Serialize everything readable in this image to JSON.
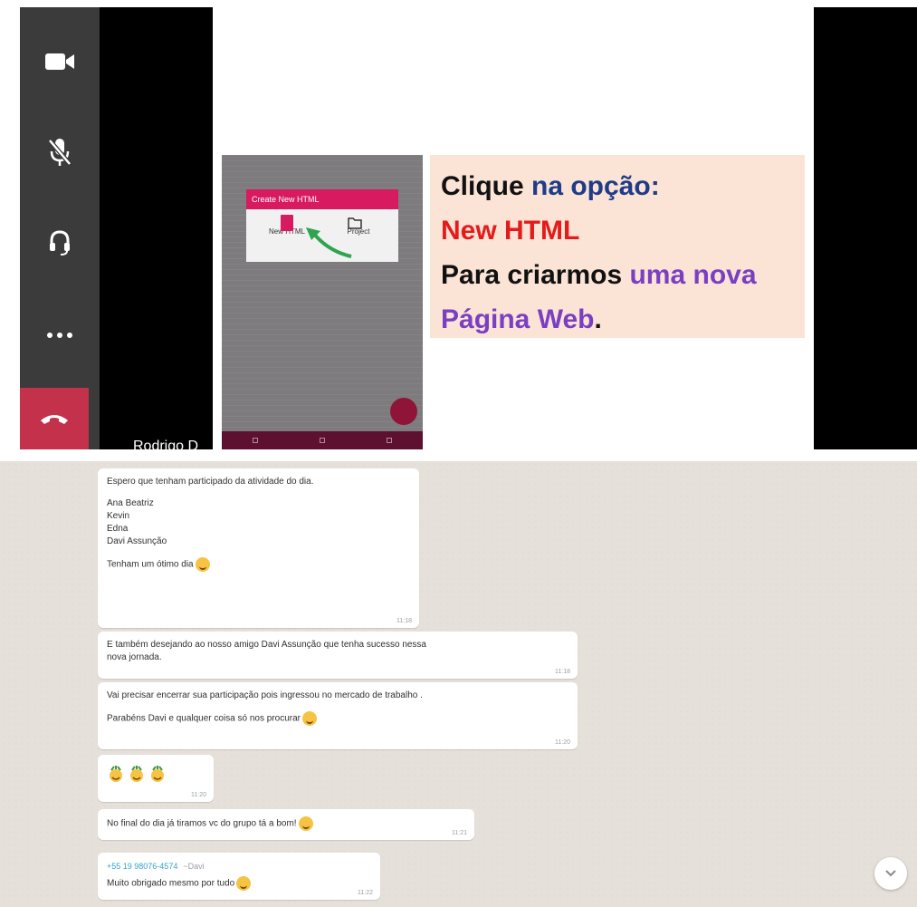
{
  "call": {
    "presenter_name": "Rodrigo D",
    "controls": {
      "camera_icon": "video-camera-icon",
      "mic_icon": "microphone-muted-icon",
      "audio_icon": "headset-icon",
      "more_icon": "more-options-icon",
      "hangup_icon": "end-call-icon",
      "hangup_color": "#c4314b"
    },
    "slide": {
      "phone": {
        "dialog_title": "Create New HTML",
        "option_1": "New HTML",
        "option_2": "Project",
        "accent_color": "#d81b60"
      },
      "callout": {
        "line1_a": "Clique ",
        "line1_b": "na opção:",
        "line2": "New HTML",
        "line3_a": "Para criarmos ",
        "line3_b": "uma nova",
        "line4_a": "Página Web",
        "line4_b": ".",
        "background": "#fbe4d5"
      }
    }
  },
  "chat": {
    "messages": [
      {
        "lines": [
          "Espero que tenham participado da atividade do dia."
        ],
        "names": [
          "Ana Beatriz",
          "Kevin",
          "Edna",
          "Davi Assunção"
        ],
        "closing": "Tenham um ótimo dia",
        "time": "11:18"
      },
      {
        "lines": [
          "E também desejando ao nosso amigo Davi Assunção que tenha sucesso nessa",
          "nova jornada."
        ],
        "time": "11:18"
      },
      {
        "line1": "Vai precisar encerrar sua participação pois ingressou no mercado de trabalho .",
        "line2": "Parabéns Davi e qualquer coisa só nos procurar",
        "time": "11:20"
      },
      {
        "emoji_count": 3,
        "time": "11:20"
      },
      {
        "text": "No final do dia já tiramos vc do grupo tá a bom!",
        "time": "11:21"
      },
      {
        "sender_phone": "+55 19 98076-4574",
        "sender_name": "~Davi",
        "text": "Muito obrigado mesmo por tudo",
        "time": "11:22"
      }
    ],
    "scroll_icon": "chevron-down-icon"
  }
}
